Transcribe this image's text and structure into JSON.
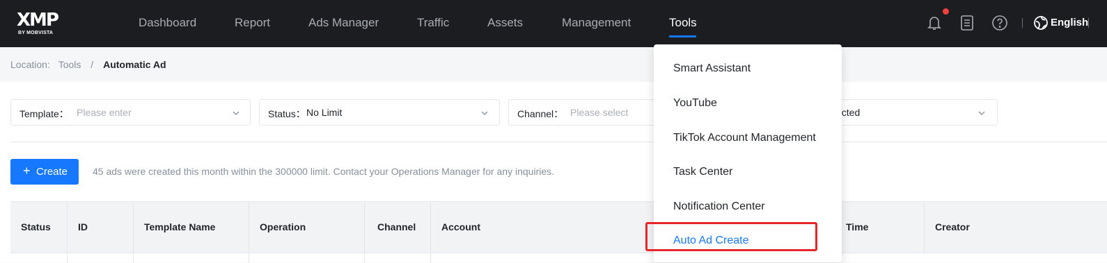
{
  "logo": {
    "mark": "XMP",
    "sub": "BY MOBVISTA"
  },
  "nav": {
    "items": [
      {
        "label": "Dashboard"
      },
      {
        "label": "Report"
      },
      {
        "label": "Ads Manager"
      },
      {
        "label": "Traffic"
      },
      {
        "label": "Assets"
      },
      {
        "label": "Management"
      },
      {
        "label": "Tools"
      }
    ],
    "active": "Tools",
    "language": "English",
    "accent": "#1677ff",
    "notification_dot": "#f53f3f"
  },
  "breadcrumb": {
    "label": "Location:",
    "parent": "Tools",
    "separator": "/",
    "current": "Automatic Ad"
  },
  "filters": {
    "template": {
      "label": "Template：",
      "placeholder": "Please enter"
    },
    "status": {
      "label": "Status：",
      "value": "No Limit"
    },
    "channel": {
      "label": "Channel：",
      "placeholder": "Please select"
    },
    "fourth": {
      "value": "ected"
    }
  },
  "create_button": {
    "icon": "plus-icon",
    "label": "Create"
  },
  "notice": "45 ads were created this month within the 300000 limit. Contact your Operations Manager for any inquiries.",
  "table": {
    "headers": [
      "Status",
      "ID",
      "Template Name",
      "Operation",
      "Channel",
      "Account",
      "Time",
      "Creator"
    ]
  },
  "tools_menu": {
    "items": [
      {
        "label": "Smart Assistant"
      },
      {
        "label": "YouTube"
      },
      {
        "label": "TikTok Account Management"
      },
      {
        "label": "Task Center"
      },
      {
        "label": "Notification Center"
      },
      {
        "label": "Auto Ad Create"
      }
    ],
    "highlighted": "Auto Ad Create",
    "highlight_color": "#e8262a"
  }
}
